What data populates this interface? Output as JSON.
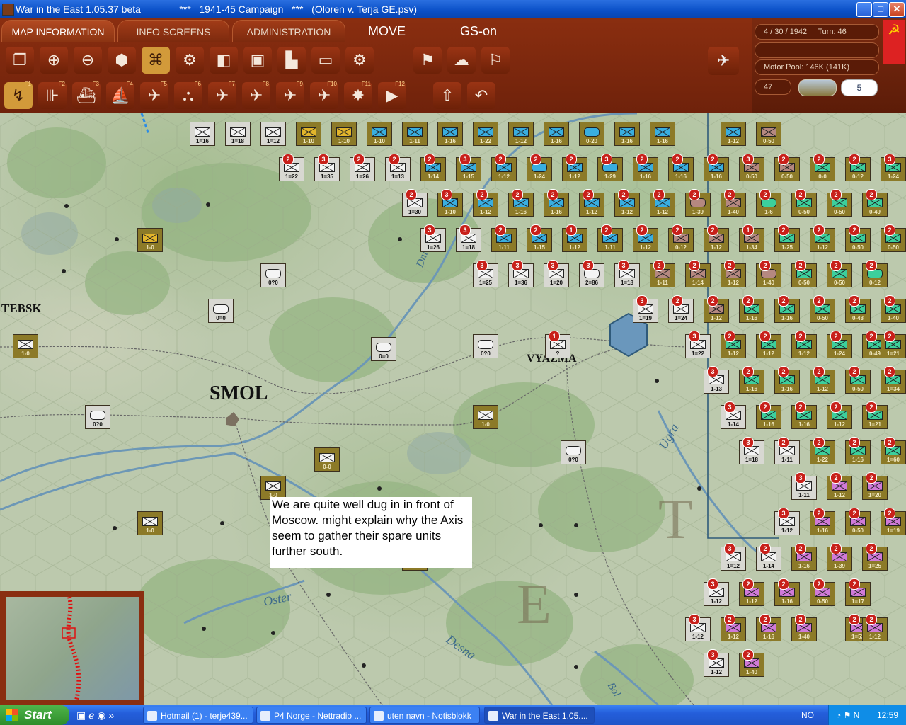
{
  "window": {
    "title": "War in the East 1.05.37 beta              ***   1941-45 Campaign   ***   (Oloren v. Terja GE.psv)",
    "minimize": "_",
    "maximize": "□",
    "close": "✕"
  },
  "tabs": [
    "MAP INFORMATION",
    "INFO SCREENS",
    "ADMINISTRATION"
  ],
  "mode": {
    "move": "MOVE",
    "gs": "GS-on"
  },
  "toolbar_row1": [
    "window-cascade-icon",
    "zoom-in-icon",
    "zoom-out-icon",
    "hex-cluster-icon",
    "select-frame-icon",
    "settings-gear-icon",
    "shape-icon",
    "monitor-icon",
    "factory-icon",
    "rectangle-icon",
    "gear-frame-icon",
    "flag-move-icon",
    "weather-icon",
    "flag-icon"
  ],
  "toolbar_row2": [
    {
      "icon": "arrow-move-icon",
      "key": "F1"
    },
    {
      "icon": "rail-icon",
      "key": "F2"
    },
    {
      "icon": "naval-icon",
      "key": "F3"
    },
    {
      "icon": "ship-icon",
      "key": "F4"
    },
    {
      "icon": "air-icon",
      "key": "F5"
    },
    {
      "icon": "supply-icon",
      "key": "F6"
    },
    {
      "icon": "airbase-icon",
      "key": "F7"
    },
    {
      "icon": "city-air-icon",
      "key": "F8"
    },
    {
      "icon": "airdrop-icon",
      "key": "F9"
    },
    {
      "icon": "interdiction-icon",
      "key": "F10"
    },
    {
      "icon": "bombard-icon",
      "key": "F11"
    },
    {
      "icon": "play-icon",
      "key": "F12"
    },
    {
      "icon": "upload-icon",
      "key": ""
    },
    {
      "icon": "undo-icon",
      "key": ""
    }
  ],
  "status": {
    "date": "4 / 30 / 1942",
    "turn": "Turn: 46",
    "motor_pool": "Motor Pool:  146K (141K)",
    "value": "47",
    "counter": "5"
  },
  "map": {
    "cities": [
      {
        "name": "TEBSK"
      },
      {
        "name": "SMOL"
      },
      {
        "name": "VYAZMA"
      }
    ],
    "rivers": [
      "Oster",
      "Desna",
      "Ugra",
      "Dni",
      "Bol"
    ],
    "note": "We are quite well dug in in front of Moscow. might explain why the Axis seem to gather their spare units further south."
  },
  "units_top_row": [
    "1=16",
    "1=18",
    "1=12",
    "1-10",
    "1-10",
    "1-10",
    "1-11",
    "1-16",
    "1-22",
    "1-12",
    "1-16",
    "0-20",
    "1-16",
    "1-16",
    "1-12",
    "0-50"
  ],
  "units_row2": [
    "1=22",
    "1=35",
    "1=26",
    "1=13",
    "1-14",
    "1-15",
    "1-12",
    "1-24",
    "1-12",
    "1-29",
    "1-16",
    "1-16",
    "1-16",
    "0-50",
    "0-50",
    "0-0",
    "0-12",
    "1-24"
  ],
  "units_row3": [
    "1=30",
    "1-10",
    "1-12",
    "1-16",
    "1-16",
    "1-12",
    "1-12",
    "1-12",
    "1-39",
    "1-40",
    "1-6",
    "0-50",
    "0-50",
    "0-49"
  ],
  "units_row4": [
    "1=26",
    "1=18",
    "1-11",
    "1-15",
    "1-12",
    "1-11",
    "1-12",
    "0-12",
    "1-12",
    "1-34",
    "1-25",
    "1-12",
    "0-50",
    "0-50"
  ],
  "units_row5": [
    "1=25",
    "1=36",
    "1=20",
    "2=86",
    "1=18",
    "1-11",
    "1-14",
    "1-12",
    "1-40",
    "0-50",
    "0-50",
    "0-12"
  ],
  "units_misc": [
    "1-0",
    "0?0",
    "0=0",
    "1-0",
    "0=0",
    "0?0",
    "?",
    "1-0",
    "0?0",
    "0-0",
    "1-0",
    "1-0",
    "1-0",
    "0?0",
    "1=19",
    "1=24",
    "1-12",
    "1-16",
    "1-16",
    "0-50",
    "0-48",
    "1-40",
    "1=22",
    "1-12",
    "1-12",
    "1-12",
    "1-24",
    "0-49",
    "1=21",
    "1-13",
    "1-16",
    "1-16",
    "1-12",
    "0-50",
    "1=34",
    "1-14",
    "1-16",
    "1-16",
    "1-12",
    "1=21",
    "1=18",
    "1-11",
    "1-22",
    "1-16",
    "1=60",
    "1-11",
    "1-12",
    "1=20",
    "1-12",
    "1-16",
    "0-50",
    "1=19",
    "1=12",
    "1-14",
    "1-16",
    "1-39",
    "1=25",
    "1-12",
    "1-12",
    "1-16",
    "0-50",
    "1=17",
    "1-12",
    "1-12",
    "1-16",
    "1-40",
    "1=53",
    "1-12",
    "1-12",
    "1-40"
  ],
  "taskbar": {
    "start": "Start",
    "tasks": [
      "Hotmail (1) - terje439...",
      "P4 Norge - Nettradio ...",
      "uten navn - Notisblokk",
      "War in the East 1.05...."
    ],
    "lang": "NO",
    "clock": "12:59"
  }
}
